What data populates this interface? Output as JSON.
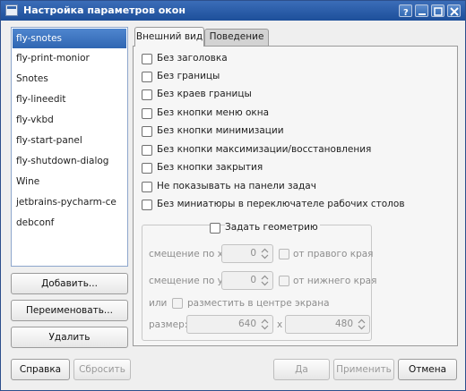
{
  "window": {
    "title": "Настройка параметров окон",
    "icons": [
      "app-window-icon",
      "help-icon",
      "minimize-icon",
      "maximize-icon",
      "close-icon"
    ]
  },
  "sidebar": {
    "items": [
      {
        "label": "fly-snotes",
        "selected": true
      },
      {
        "label": "fly-print-monior",
        "selected": false
      },
      {
        "label": "Snotes",
        "selected": false
      },
      {
        "label": "fly-lineedit",
        "selected": false
      },
      {
        "label": "fly-vkbd",
        "selected": false
      },
      {
        "label": "fly-start-panel",
        "selected": false
      },
      {
        "label": "fly-shutdown-dialog",
        "selected": false
      },
      {
        "label": "Wine",
        "selected": false
      },
      {
        "label": "jetbrains-pycharm-ce",
        "selected": false
      },
      {
        "label": "debconf",
        "selected": false
      }
    ],
    "add_label": "Добавить...",
    "rename_label": "Переименовать...",
    "delete_label": "Удалить"
  },
  "tabs": [
    {
      "label": "Внешний вид",
      "active": true
    },
    {
      "label": "Поведение",
      "active": false
    }
  ],
  "appearance": {
    "options": [
      "Без заголовка",
      "Без границы",
      "Без краев границы",
      "Без кнопки меню окна",
      "Без кнопки минимизации",
      "Без кнопки максимизации/восстановления",
      "Без кнопки закрытия",
      "Не показывать на панели задач",
      "Без миниатюры в переключателе рабочих столов"
    ],
    "geometry": {
      "title": "Задать геометрию",
      "offset_x_label": "смещение по x:",
      "offset_x_value": "0",
      "from_right_label": "от правого края",
      "offset_y_label": "смещение по y:",
      "offset_y_value": "0",
      "from_bottom_label": "от нижнего края",
      "or_label": "или",
      "center_label": "разместить в центре экрана",
      "size_label": "размер:",
      "width_value": "640",
      "times_label": "x",
      "height_value": "480"
    }
  },
  "footer": {
    "help_label": "Справка",
    "reset_label": "Сбросить",
    "ok_label": "Да",
    "apply_label": "Применить",
    "cancel_label": "Отмена"
  },
  "colors": {
    "titlebar": "#2a5ca8",
    "selection": "#3a72bf",
    "window_bg": "#efefef"
  }
}
